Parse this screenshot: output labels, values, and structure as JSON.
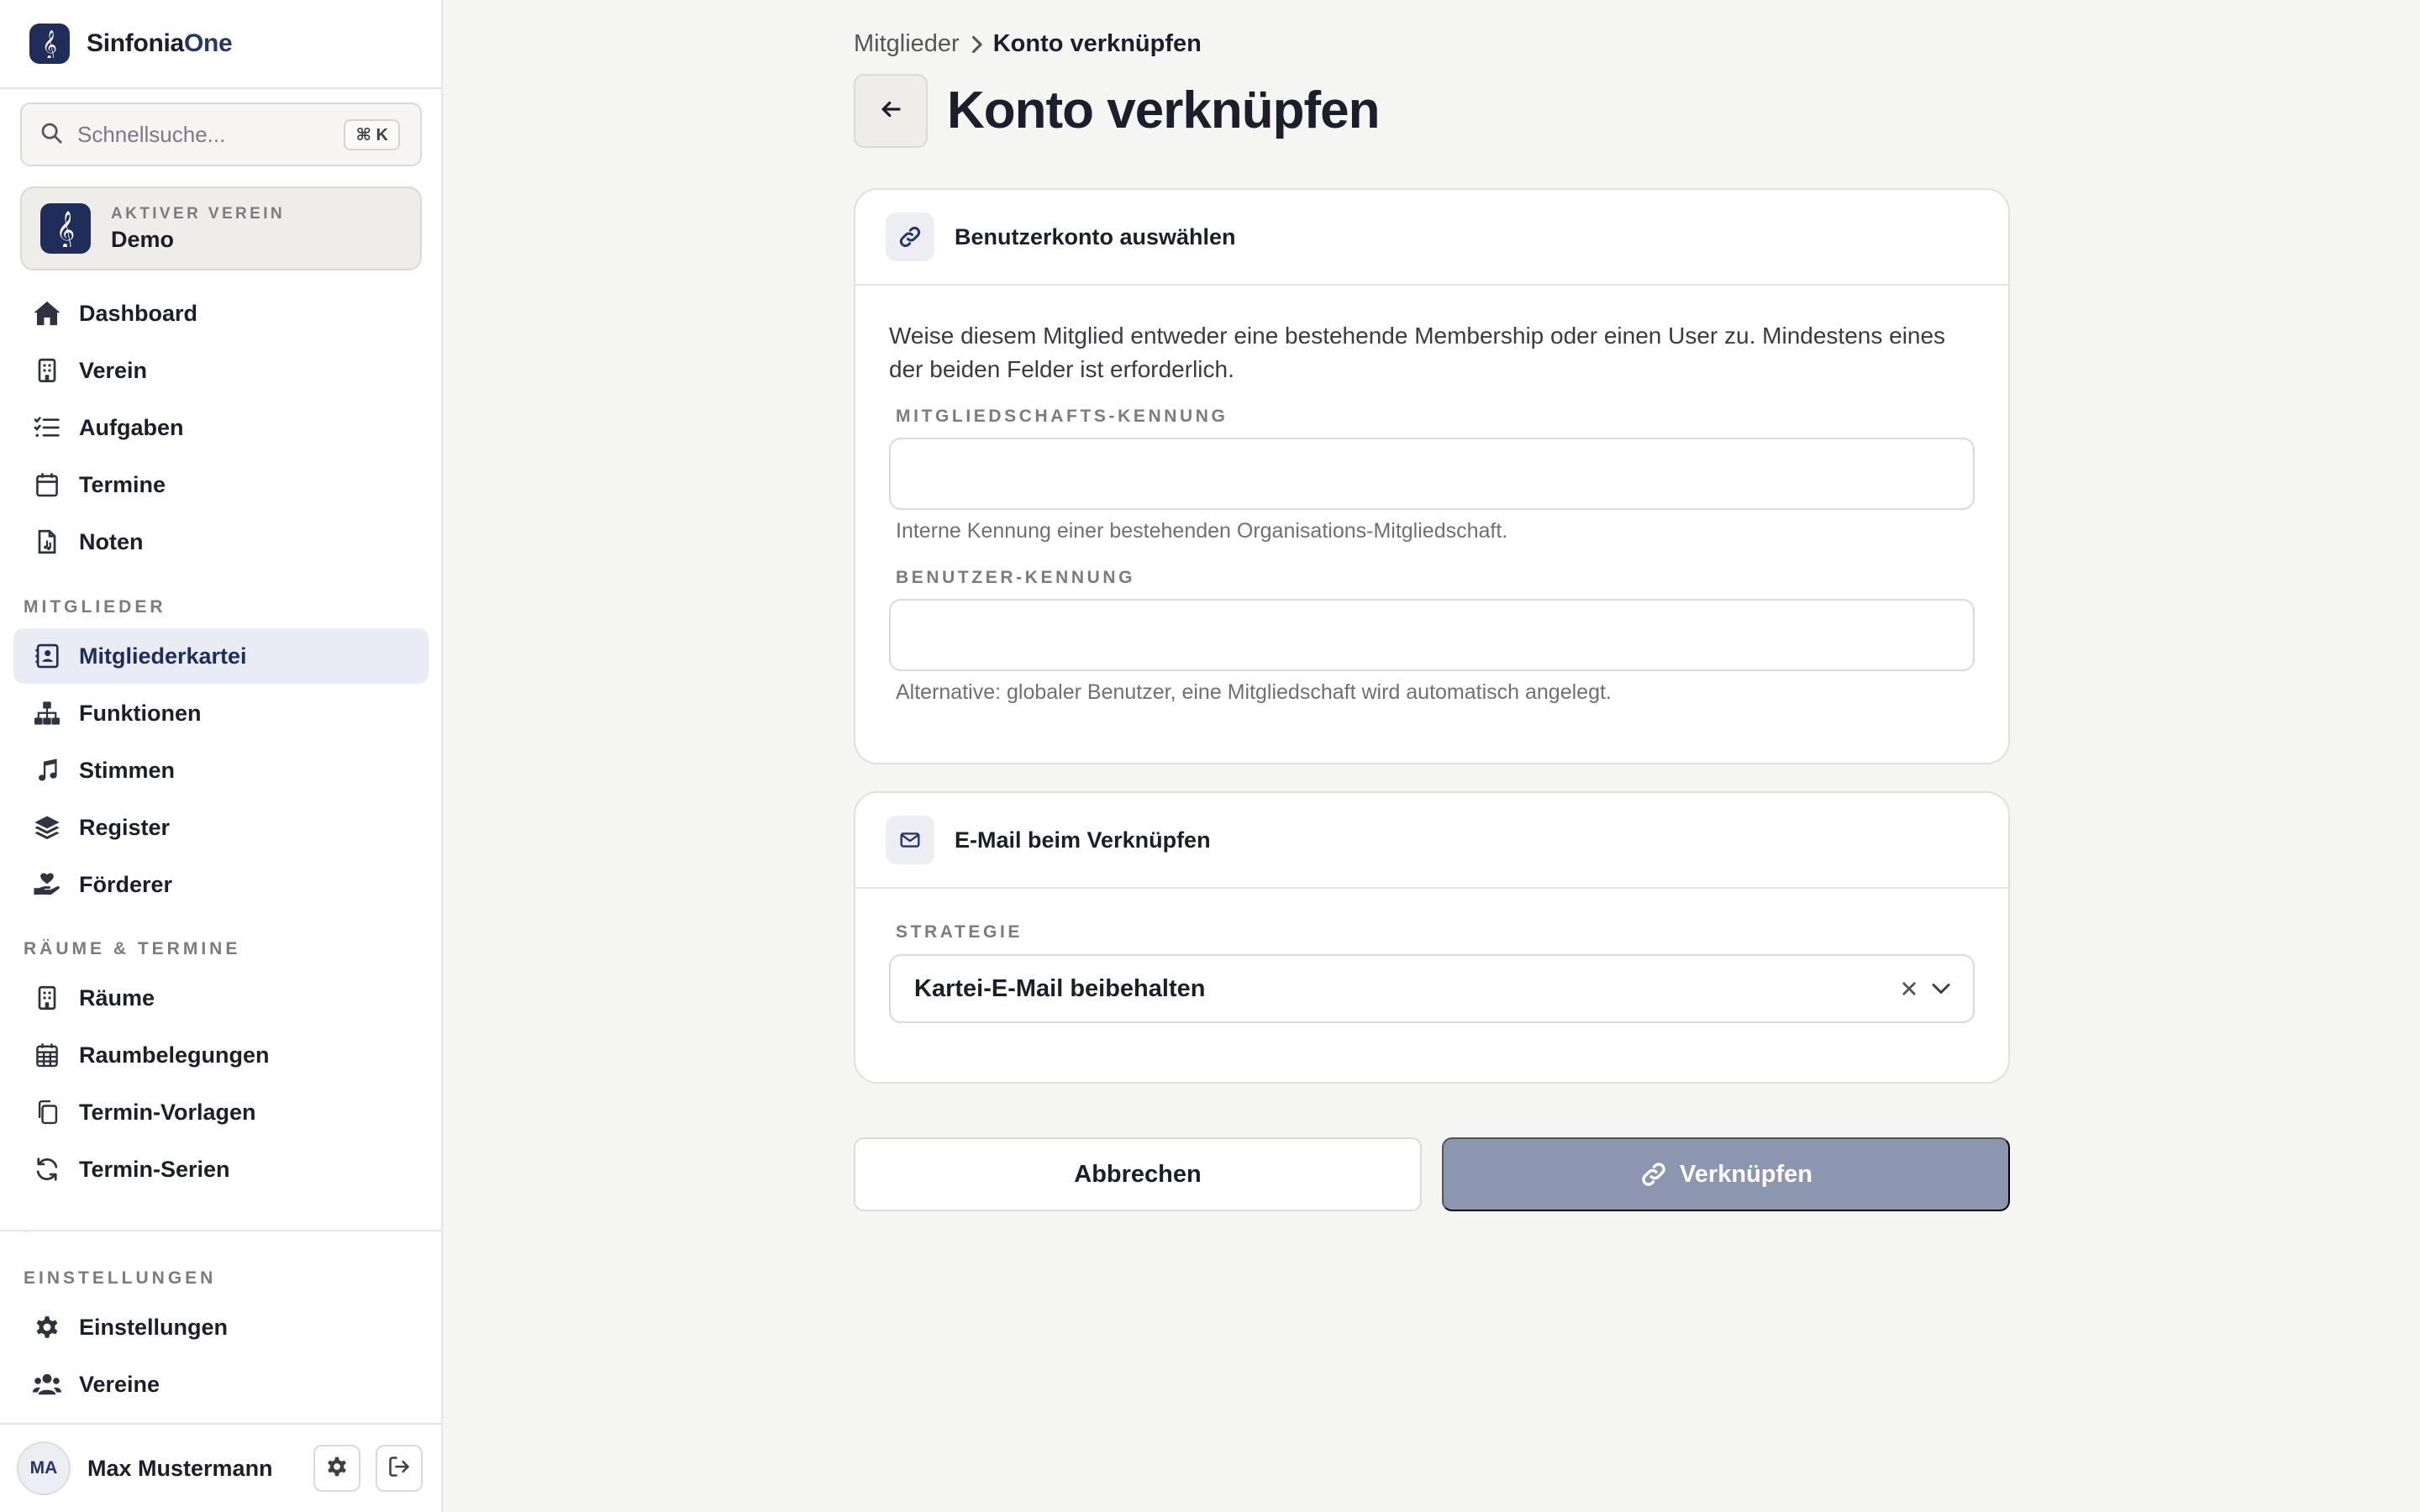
{
  "app": {
    "brand_part1": "Sinfonia",
    "brand_part2": "One"
  },
  "search": {
    "placeholder": "Schnellsuche...",
    "shortcut": "⌘ K"
  },
  "club": {
    "kicker": "AKTIVER VEREIN",
    "name": "Demo"
  },
  "nav": {
    "main": [
      {
        "label": "Dashboard",
        "icon": "home-icon"
      },
      {
        "label": "Verein",
        "icon": "building-icon"
      },
      {
        "label": "Aufgaben",
        "icon": "task-list-icon"
      },
      {
        "label": "Termine",
        "icon": "calendar-icon"
      },
      {
        "label": "Noten",
        "icon": "sheet-music-icon"
      }
    ],
    "members_section": "MITGLIEDER",
    "members": [
      {
        "label": "Mitgliederkartei",
        "icon": "contact-card-icon",
        "active": true
      },
      {
        "label": "Funktionen",
        "icon": "org-chart-icon"
      },
      {
        "label": "Stimmen",
        "icon": "music-note-icon"
      },
      {
        "label": "Register",
        "icon": "layers-icon"
      },
      {
        "label": "Förderer",
        "icon": "hand-heart-icon"
      }
    ],
    "rooms_section": "RÄUME & TERMINE",
    "rooms": [
      {
        "label": "Räume",
        "icon": "building-icon"
      },
      {
        "label": "Raumbelegungen",
        "icon": "calendar-grid-icon"
      },
      {
        "label": "Termin-Vorlagen",
        "icon": "copy-icon"
      },
      {
        "label": "Termin-Serien",
        "icon": "refresh-icon"
      }
    ],
    "settings_section": "EINSTELLUNGEN",
    "settings": [
      {
        "label": "Einstellungen",
        "icon": "gear-icon"
      },
      {
        "label": "Vereine",
        "icon": "users-icon"
      }
    ]
  },
  "user": {
    "initials": "MA",
    "name": "Max Mustermann"
  },
  "breadcrumb": {
    "parent": "Mitglieder",
    "current": "Konto verknüpfen"
  },
  "page": {
    "title": "Konto verknüpfen"
  },
  "account_card": {
    "title": "Benutzerkonto auswählen",
    "description": "Weise diesem Mitglied entweder eine bestehende Membership oder einen User zu. Mindestens eines der beiden Felder ist erforderlich.",
    "membership_label": "MITGLIEDSCHAFTS-KENNUNG",
    "membership_value": "",
    "membership_help": "Interne Kennung einer bestehenden Organisations-Mitgliedschaft.",
    "user_label": "BENUTZER-KENNUNG",
    "user_value": "",
    "user_help": "Alternative: globaler Benutzer, eine Mitgliedschaft wird automatisch angelegt."
  },
  "email_card": {
    "title": "E-Mail beim Verknüpfen",
    "strategy_label": "STRATEGIE",
    "strategy_value": "Kartei-E-Mail beibehalten"
  },
  "actions": {
    "cancel": "Abbrechen",
    "link": "Verknüpfen"
  },
  "colors": {
    "brand": "#1f2d5a",
    "accent": "#27356e",
    "active_bg": "#e9ecf4",
    "disabled_primary": "#8d96b0"
  }
}
